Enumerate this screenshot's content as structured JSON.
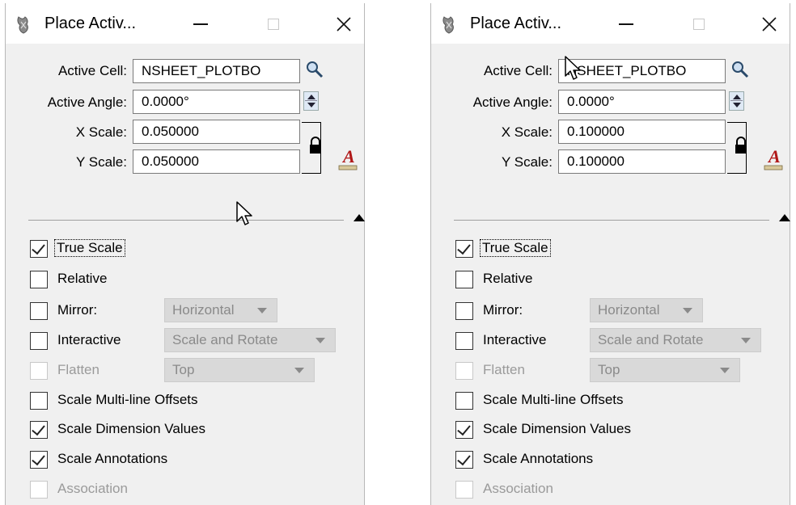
{
  "windows": [
    {
      "title": "Place Activ...",
      "active_cell_label": "Active Cell:",
      "active_cell_value": "NSHEET_PLOTBO",
      "active_angle_label": "Active Angle:",
      "active_angle_value": "0.0000°",
      "x_scale_label": "X Scale:",
      "x_scale_value": "0.050000",
      "y_scale_label": "Y Scale:",
      "y_scale_value": "0.050000",
      "options": {
        "true_scale": {
          "label": "True Scale",
          "checked": true
        },
        "relative": {
          "label": "Relative",
          "checked": false
        },
        "mirror": {
          "label": "Mirror:",
          "checked": false,
          "dropdown": "Horizontal"
        },
        "interactive": {
          "label": "Interactive",
          "checked": false,
          "dropdown": "Scale and Rotate"
        },
        "flatten": {
          "label": "Flatten",
          "checked": false,
          "disabled": true,
          "dropdown": "Top"
        },
        "scale_multiline": {
          "label": "Scale Multi-line Offsets",
          "checked": false
        },
        "scale_dimension": {
          "label": "Scale Dimension Values",
          "checked": true
        },
        "scale_annotations": {
          "label": "Scale Annotations",
          "checked": true
        },
        "association": {
          "label": "Association",
          "checked": false,
          "disabled": true
        }
      }
    },
    {
      "title": "Place Activ...",
      "active_cell_label": "Active Cell:",
      "active_cell_value": "NSHEET_PLOTBO",
      "active_angle_label": "Active Angle:",
      "active_angle_value": "0.0000°",
      "x_scale_label": "X Scale:",
      "x_scale_value": "0.100000",
      "y_scale_label": "Y Scale:",
      "y_scale_value": "0.100000",
      "options": {
        "true_scale": {
          "label": "True Scale",
          "checked": true
        },
        "relative": {
          "label": "Relative",
          "checked": false
        },
        "mirror": {
          "label": "Mirror:",
          "checked": false,
          "dropdown": "Horizontal"
        },
        "interactive": {
          "label": "Interactive",
          "checked": false,
          "dropdown": "Scale and Rotate"
        },
        "flatten": {
          "label": "Flatten",
          "checked": false,
          "disabled": true,
          "dropdown": "Top"
        },
        "scale_multiline": {
          "label": "Scale Multi-line Offsets",
          "checked": false
        },
        "scale_dimension": {
          "label": "Scale Dimension Values",
          "checked": true
        },
        "scale_annotations": {
          "label": "Scale Annotations",
          "checked": true
        },
        "association": {
          "label": "Association",
          "checked": false,
          "disabled": true
        }
      }
    }
  ],
  "colors": {
    "window_bg": "#f0f0f0",
    "titlebar_bg": "#ffffff",
    "disabled_text": "#9a9a9a",
    "dropdown_bg": "#d9d9d9"
  }
}
